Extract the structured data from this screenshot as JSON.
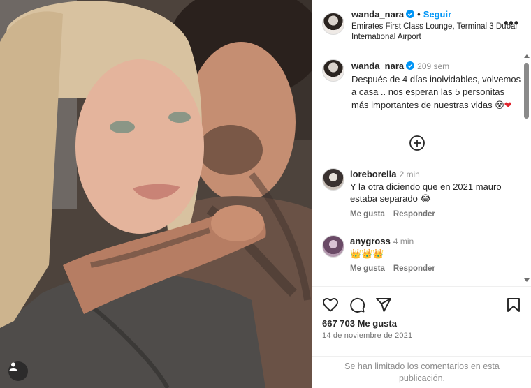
{
  "post": {
    "username": "wanda_nara",
    "separator": "•",
    "follow_label": "Seguir",
    "location": "Emirates First Class Lounge, Terminal 3 Dubai International Airport",
    "more_label": "•••"
  },
  "caption": {
    "username": "wanda_nara",
    "time": "209 sem",
    "text": "Después de 4 días inolvidables, volvemos a casa .. nos esperan las 5 personitas más importantes de nuestras vidas 😵",
    "heart": "❤"
  },
  "comments": [
    {
      "username": "loreborella",
      "time": "2 min",
      "text": "Y la otra diciendo que en 2021 mauro estaba separado 😂",
      "like_label": "Me gusta",
      "reply_label": "Responder"
    },
    {
      "username": "anygross",
      "time": "4 min",
      "text": "👑👑👑",
      "like_label": "Me gusta",
      "reply_label": "Responder"
    }
  ],
  "stats": {
    "likes": "667 703 Me gusta",
    "date": "14 de noviembre de 2021"
  },
  "footer": {
    "limited_text": "Se han limitado los comentarios en esta publicación."
  },
  "icons": {
    "verified": "verified-badge-icon",
    "load_more": "plus-circle-icon",
    "like": "heart-outline-icon",
    "comment": "speech-bubble-icon",
    "share": "paper-plane-icon",
    "save": "bookmark-icon",
    "tagged_user": "user-icon"
  },
  "colors": {
    "accent": "#0095f6",
    "verified": "#0095f6",
    "heart": "#e0242d",
    "secondary_text": "#8e8e8e"
  }
}
